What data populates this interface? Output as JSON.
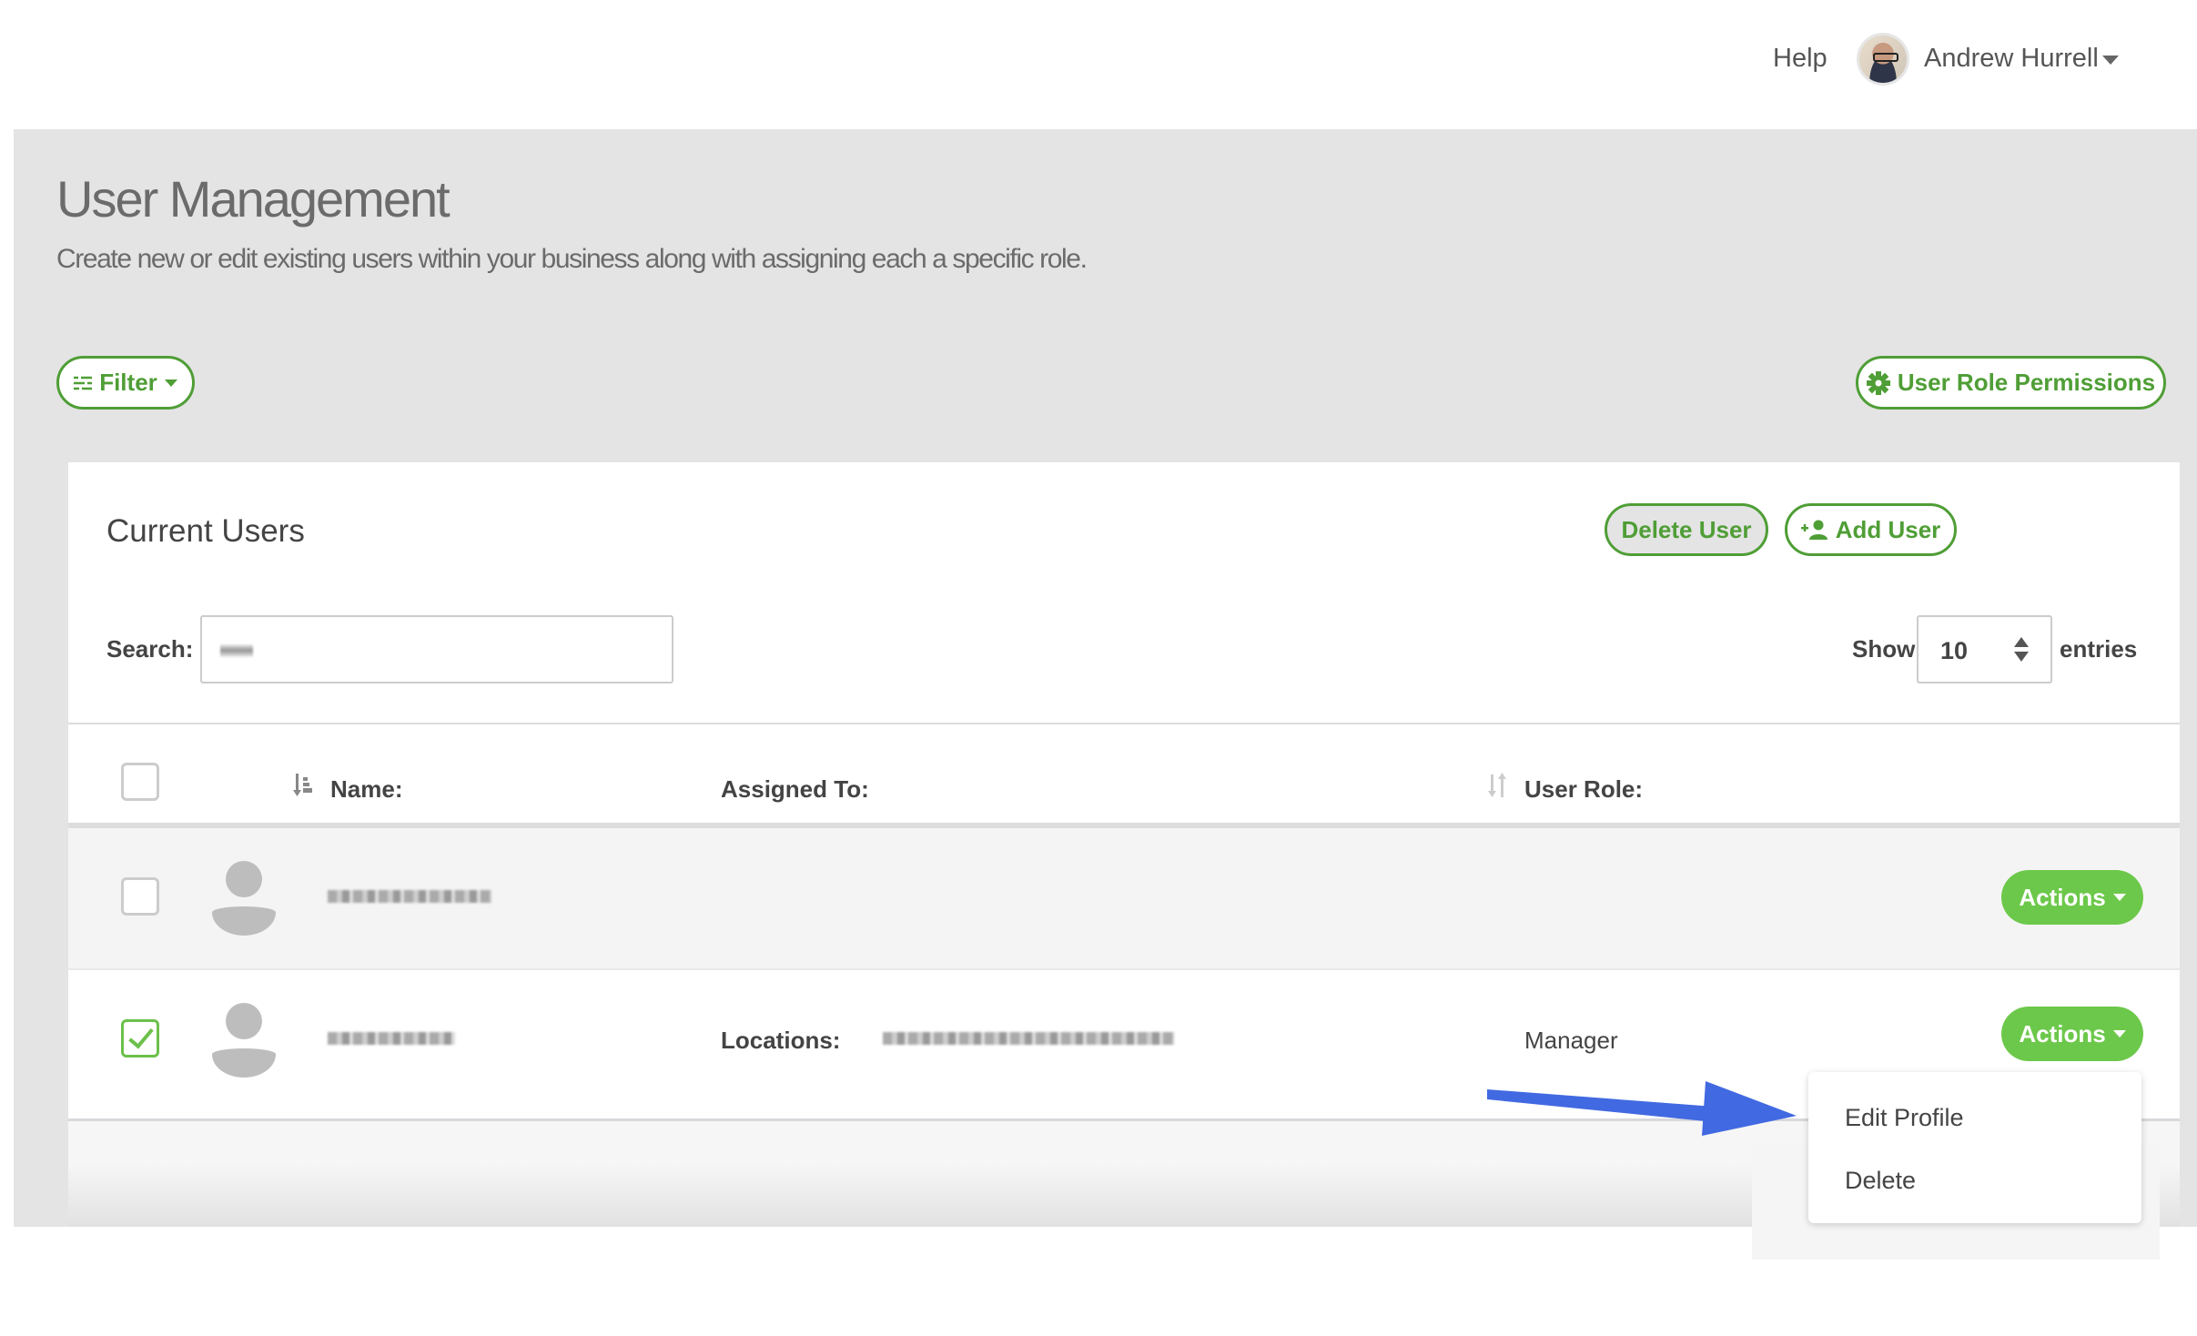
{
  "topbar": {
    "help_label": "Help",
    "user_name": "Andrew Hurrell",
    "avatar_icon": "user-avatar-photo",
    "caret_icon": "caret-down-icon"
  },
  "header": {
    "title": "User Management",
    "subtitle": "Create new or edit existing users within your business along with assigning each a specific role."
  },
  "toolbar": {
    "filter_label": "Filter",
    "filter_icon": "sliders-icon",
    "urp_label": "User Role Permissions",
    "urp_icon": "gear-icon"
  },
  "card": {
    "title": "Current Users",
    "delete_user_label": "Delete User",
    "add_user_label": "Add User",
    "add_user_icon": "user-plus-icon",
    "search": {
      "label": "Search:",
      "value": "[redacted]"
    },
    "show": {
      "label": "Show",
      "value": "10",
      "suffix": "entries"
    },
    "table": {
      "columns": [
        "Name:",
        "Assigned To:",
        "User Role:"
      ],
      "rows": [
        {
          "checked": false,
          "name": "[redacted]",
          "assigned_label": "",
          "assigned_value": "",
          "role": "",
          "actions_label": "Actions"
        },
        {
          "checked": true,
          "name": "[redacted]",
          "assigned_label": "Locations:",
          "assigned_value": "[redacted]",
          "role": "Manager",
          "actions_label": "Actions"
        }
      ]
    }
  },
  "dropdown": {
    "items": [
      "Edit Profile",
      "Delete"
    ]
  },
  "colors": {
    "brand_green": "#4f9e36",
    "action_green": "#6cc84a",
    "annotation_blue": "#4169e1",
    "page_bg": "#e4e4e4"
  }
}
